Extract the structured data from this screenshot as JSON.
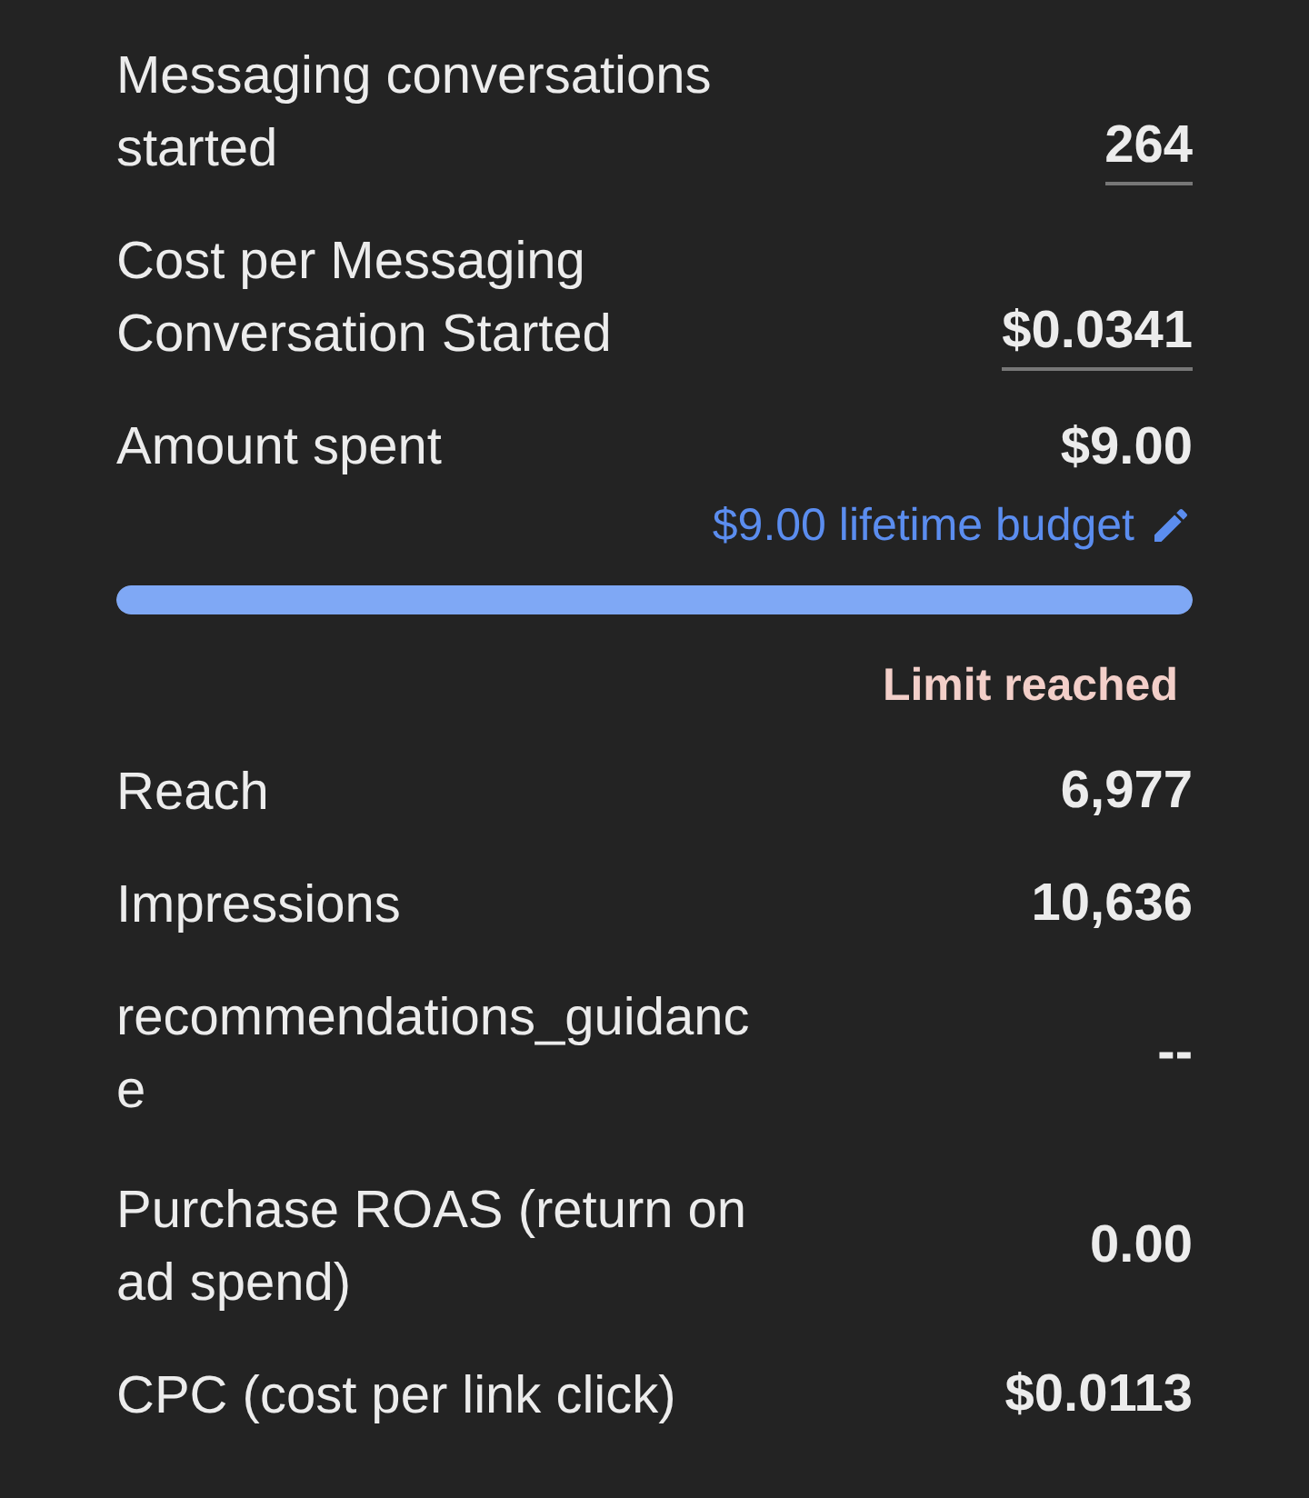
{
  "metrics_top": [
    {
      "label": "Messaging conversations started",
      "value": "264",
      "underlined": true
    },
    {
      "label": "Cost per Messaging Conversation Started",
      "value": "$0.0341",
      "underlined": true
    }
  ],
  "budget": {
    "label": "Amount spent",
    "value": "$9.00",
    "budget_link": "$9.00 lifetime budget",
    "level": 1,
    "status": "Limit reached"
  },
  "metrics_bottom": [
    {
      "label": "Reach",
      "value": "6,977"
    },
    {
      "label": "Impressions",
      "value": "10,636"
    },
    {
      "label": "recommendations_guidanc e",
      "value": "--"
    },
    {
      "label": "Purchase ROAS (return on ad spend)",
      "value": "0.00"
    },
    {
      "label": "CPC (cost per link click)",
      "value": "$0.0113"
    }
  ]
}
